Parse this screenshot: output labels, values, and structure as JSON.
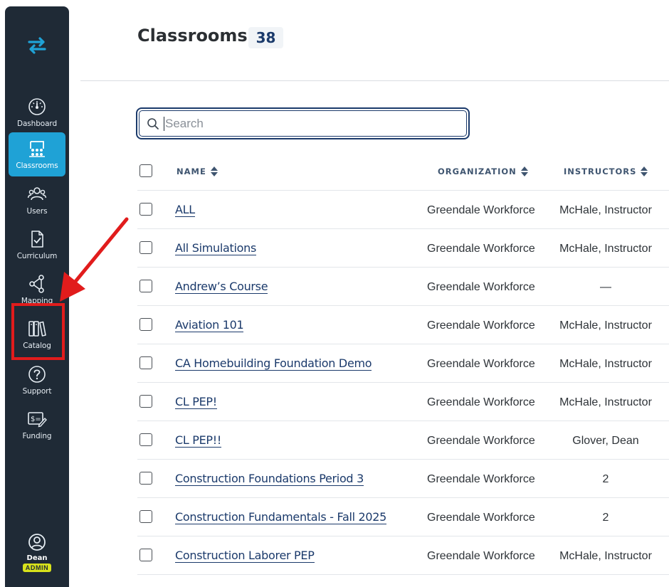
{
  "sidebar": {
    "brand_icon": "swap-arrows-icon",
    "items": [
      {
        "label": "Dashboard",
        "icon": "gauge-icon"
      },
      {
        "label": "Classrooms",
        "icon": "classroom-icon",
        "active": true
      },
      {
        "label": "Users",
        "icon": "users-icon"
      },
      {
        "label": "Curriculum",
        "icon": "document-check-icon"
      },
      {
        "label": "Mapping",
        "icon": "share-nodes-icon"
      },
      {
        "label": "Catalog",
        "icon": "books-icon"
      },
      {
        "label": "Support",
        "icon": "help-circle-icon"
      },
      {
        "label": "Funding",
        "icon": "dollar-doc-icon"
      }
    ],
    "user": {
      "name": "Dean",
      "role": "ADMIN"
    }
  },
  "header": {
    "title": "Classrooms",
    "count": "38"
  },
  "search": {
    "placeholder": "Search",
    "value": ""
  },
  "table": {
    "columns": {
      "name": "NAME",
      "organization": "ORGANIZATION",
      "instructors": "INSTRUCTORS"
    },
    "rows": [
      {
        "name": "ALL",
        "organization": "Greendale Workforce",
        "instructors": "McHale, Instructor"
      },
      {
        "name": "All Simulations",
        "organization": "Greendale Workforce",
        "instructors": "McHale, Instructor"
      },
      {
        "name": "Andrew’s Course",
        "organization": "Greendale Workforce",
        "instructors": "—"
      },
      {
        "name": "Aviation 101",
        "organization": "Greendale Workforce",
        "instructors": "McHale, Instructor"
      },
      {
        "name": "CA Homebuilding Foundation Demo",
        "organization": "Greendale Workforce",
        "instructors": "McHale, Instructor"
      },
      {
        "name": "CL PEP!",
        "organization": "Greendale Workforce",
        "instructors": "McHale, Instructor"
      },
      {
        "name": "CL PEP!!",
        "organization": "Greendale Workforce",
        "instructors": "Glover, Dean"
      },
      {
        "name": "Construction Foundations Period 3",
        "organization": "Greendale Workforce",
        "instructors": "2"
      },
      {
        "name": "Construction Fundamentals - Fall 2025",
        "organization": "Greendale Workforce",
        "instructors": "2"
      },
      {
        "name": "Construction Laborer PEP",
        "organization": "Greendale Workforce",
        "instructors": "McHale, Instructor"
      }
    ]
  },
  "colors": {
    "sidebar_bg": "#1f2a36",
    "active_nav": "#1fa2d6",
    "link": "#1b3a6b",
    "annotation": "#e11c1c",
    "role_badge": "#d8e21b"
  }
}
